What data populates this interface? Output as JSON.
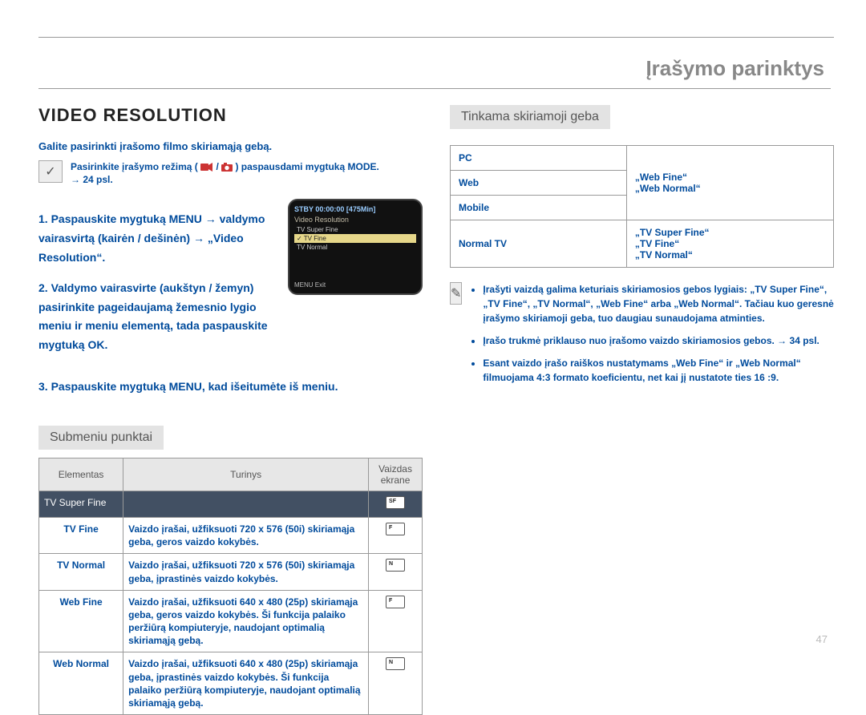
{
  "header": {
    "chapter": "Įrašymo parinktys"
  },
  "left": {
    "title": "VIDEO RESOLUTION",
    "lead": "Galite pasirinkti įrašomo filmo skiriamąją gebą.",
    "modeNote1": "Pasirinkite įrašymo režimą (",
    "modeNote2": " / ",
    "modeNote3": ") paspausdami mygtuką MODE.",
    "modePage": "→ 24 psl.",
    "step1": "1. Paspauskite mygtuką MENU → valdymo vairasvirtą (kairėn / dešinėn) → „Video Resolution“.",
    "step2": "2. Valdymo vairasvirte (aukštyn / žemyn) pasirinkite pageidaujamą žemesnio lygio meniu ir meniu elementą, tada paspauskite mygtuką OK.",
    "step3": "3. Paspauskite mygtuką MENU, kad išeitumėte iš meniu.",
    "lcd": {
      "stby": "STBY 00:00:00 [475Min]",
      "title": "Video Resolution",
      "opt1": "TV Super Fine",
      "opt2": "TV Fine",
      "opt3": "TV Normal",
      "exit": "MENU Exit"
    },
    "submenuHeading": "Submeniu punktai",
    "table": {
      "h1": "Elementas",
      "h2": "Turinys",
      "h3": "Vaizdas ekrane",
      "r1n": "TV Super Fine",
      "r2n": "TV Fine",
      "r2d": "Vaizdo įrašai, užfiksuoti 720 x 576 (50i) skiriamąja geba, geros vaizdo kokybės.",
      "r3n": "TV Normal",
      "r3d": "Vaizdo įrašai, užfiksuoti 720 x 576 (50i) skiriamąja geba, įprastinės vaizdo kokybės.",
      "r4n": "Web Fine",
      "r4d": "Vaizdo įrašai, užfiksuoti 640 x 480 (25p) skiriamąja geba, geros vaizdo kokybės. Ši funkcija palaiko peržiūrą kompiuteryje, naudojant optimalią skiriamąją gebą.",
      "r5n": "Web Normal",
      "r5d": "Vaizdo įrašai, užfiksuoti 640 x 480 (25p) skiriamąja geba, įprastinės vaizdo kokybės. Ši funkcija palaiko peržiūrą kompiuteryje, naudojant optimalią skiriamąją gebą."
    }
  },
  "right": {
    "heading": "Tinkama skiriamoji geba",
    "tbl": {
      "r1l": "PC",
      "r1v1": "„Web Fine“",
      "r1v2": "„Web Normal“",
      "r2l1": "Web",
      "r2l2": "Mobile",
      "r3l": "Normal TV",
      "r3v1": "„TV Super Fine“",
      "r3v2": "„TV Fine“",
      "r3v3": "„TV Normal“"
    },
    "notes": {
      "n1": "Įrašyti vaizdą galima keturiais skiriamosios gebos lygiais: „TV Super Fine“, „TV Fine“, „TV Normal“, „Web Fine“ arba „Web Normal“. Tačiau kuo geresnė įrašymo skiriamoji geba, tuo daugiau sunaudojama atminties.",
      "n2": "Įrašo trukmė priklauso nuo įrašomo vaizdo skiriamosios gebos. → 34 psl.",
      "n3": "Esant vaizdo įrašo raiškos nustatymams „Web Fine“ ir „Web Normal“ filmuojama 4:3 formato koeficientu, net kai jį nustatote ties 16 :9."
    }
  },
  "pageNumber": "47"
}
